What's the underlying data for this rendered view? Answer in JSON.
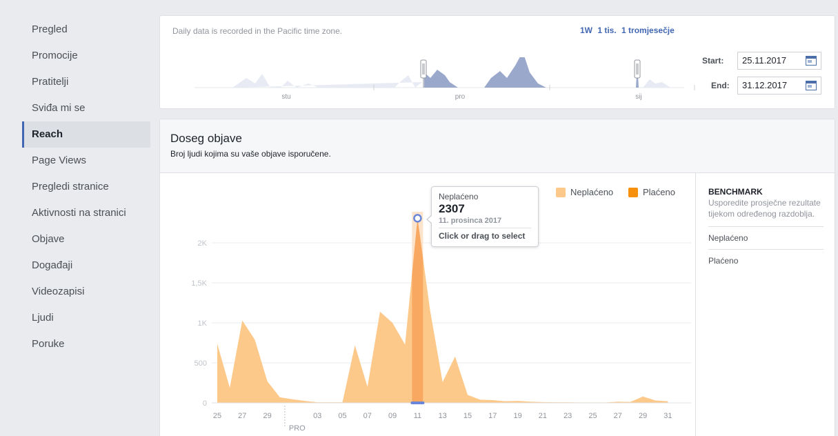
{
  "sidebar": {
    "items": [
      {
        "label": "Pregled",
        "active": false
      },
      {
        "label": "Promocije",
        "active": false
      },
      {
        "label": "Pratitelji",
        "active": false
      },
      {
        "label": "Sviđa mi se",
        "active": false
      },
      {
        "label": "Reach",
        "active": true
      },
      {
        "label": "Page Views",
        "active": false
      },
      {
        "label": "Pregledi stranice",
        "active": false
      },
      {
        "label": "Aktivnosti na stranici",
        "active": false
      },
      {
        "label": "Objave",
        "active": false
      },
      {
        "label": "Događaji",
        "active": false
      },
      {
        "label": "Videozapisi",
        "active": false
      },
      {
        "label": "Ljudi",
        "active": false
      },
      {
        "label": "Poruke",
        "active": false
      }
    ]
  },
  "timeline": {
    "note": "Daily data is recorded in the Pacific time zone.",
    "ranges": [
      "1W",
      "1 tis.",
      "1 tromjesečje"
    ],
    "month_labels": [
      "stu",
      "pro",
      "sij"
    ],
    "start_label": "Start:",
    "start_value": "25.11.2017",
    "end_label": "End:",
    "end_value": "31.12.2017",
    "calendar_icon": "calendar-icon"
  },
  "reach": {
    "title": "Doseg objave",
    "subtitle": "Broj ljudi kojima su vaše objave isporučene."
  },
  "legend": {
    "unpaid": "Neplaćeno",
    "paid": "Plaćeno"
  },
  "tooltip": {
    "label": "Neplaćeno",
    "value": "2307",
    "date": "11. prosinca 2017",
    "hint": "Click or drag to select"
  },
  "benchmark": {
    "title": "BENCHMARK",
    "description": "Usporedite prosječne rezultate tijekom određenog razdoblja.",
    "items": [
      "Neplaćeno",
      "Plaćeno"
    ]
  },
  "colors": {
    "unpaid": "#fdc98b",
    "paid": "#f6900d",
    "highlight": "#f7a45c",
    "marker": "#6a86d8",
    "timeline_fill": "#9aa8cc"
  },
  "chart_data": {
    "type": "area",
    "x": [
      "25",
      "26",
      "27",
      "28",
      "29",
      "30",
      "01",
      "02",
      "03",
      "04",
      "05",
      "06",
      "07",
      "08",
      "09",
      "10",
      "11",
      "12",
      "13",
      "14",
      "15",
      "16",
      "17",
      "18",
      "19",
      "20",
      "21",
      "22",
      "23",
      "24",
      "25",
      "26",
      "27",
      "28",
      "29",
      "30",
      "31"
    ],
    "x_tick_labels": [
      "25",
      "27",
      "29",
      "03",
      "05",
      "07",
      "09",
      "11",
      "13",
      "15",
      "17",
      "19",
      "21",
      "23",
      "25",
      "27",
      "29",
      "31"
    ],
    "month_marker": "PRO",
    "y_ticks": [
      "0",
      "500",
      "1K",
      "1,5K",
      "2K"
    ],
    "ylim": [
      0,
      2500
    ],
    "series": [
      {
        "name": "Neplaćeno",
        "values": [
          740,
          190,
          1030,
          790,
          270,
          70,
          45,
          25,
          8,
          8,
          8,
          720,
          200,
          1140,
          1000,
          730,
          2307,
          1160,
          260,
          580,
          100,
          40,
          35,
          20,
          25,
          15,
          10,
          8,
          8,
          5,
          5,
          5,
          15,
          12,
          80,
          30,
          20
        ]
      },
      {
        "name": "Plaćeno",
        "values": [
          0,
          0,
          0,
          0,
          0,
          0,
          0,
          0,
          0,
          0,
          0,
          0,
          0,
          0,
          0,
          0,
          0,
          0,
          0,
          0,
          0,
          0,
          0,
          0,
          0,
          0,
          0,
          0,
          0,
          0,
          0,
          0,
          0,
          0,
          0,
          0,
          0
        ]
      }
    ],
    "highlight_index": 16,
    "grid": true,
    "legend_position": "top-right"
  }
}
